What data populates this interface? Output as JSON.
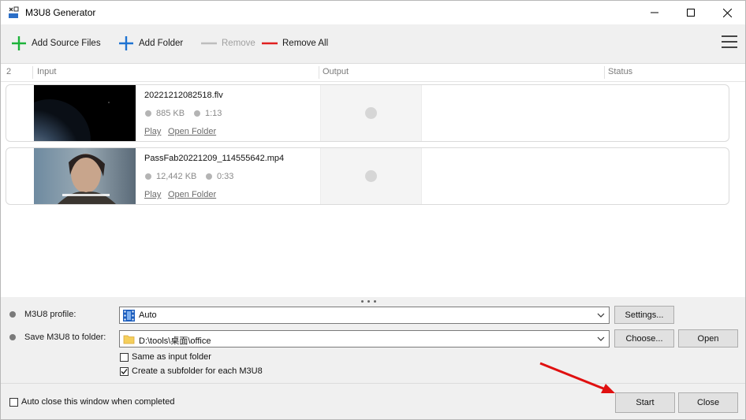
{
  "window": {
    "title": "M3U8 Generator"
  },
  "toolbar": {
    "add_files": "Add Source Files",
    "add_folder": "Add Folder",
    "remove": "Remove",
    "remove_all": "Remove All",
    "colors": {
      "add_files": "#1db33a",
      "add_folder": "#1e73d2",
      "remove": "#bdbdbd",
      "remove_all": "#e02020"
    }
  },
  "list": {
    "count": "2",
    "headers": {
      "input": "Input",
      "output": "Output",
      "status": "Status"
    },
    "items": [
      {
        "name": "20221212082518.flv",
        "size": "885 KB",
        "duration": "1:13",
        "play": "Play",
        "open_folder": "Open Folder"
      },
      {
        "name": "PassFab20221209_114555642.mp4",
        "size": "12,442 KB",
        "duration": "0:33",
        "play": "Play",
        "open_folder": "Open Folder"
      }
    ]
  },
  "options": {
    "profile_label": "M3U8 profile:",
    "profile_value": "Auto",
    "settings_btn": "Settings...",
    "folder_label": "Save M3U8 to folder:",
    "folder_value": "D:\\tools\\桌面\\office",
    "choose_btn": "Choose...",
    "open_btn": "Open",
    "same_as_input": "Same as input folder",
    "same_as_input_checked": false,
    "create_subfolder": "Create a subfolder for each M3U8",
    "create_subfolder_checked": true
  },
  "footer": {
    "auto_close": "Auto close this window when completed",
    "auto_close_checked": false,
    "start_btn": "Start",
    "close_btn": "Close"
  }
}
